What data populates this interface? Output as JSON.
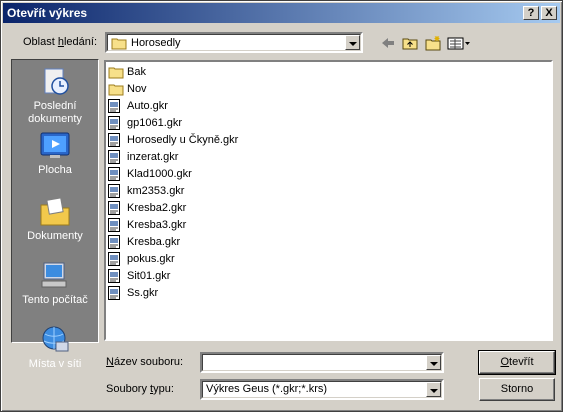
{
  "window": {
    "title": "Otevřít výkres"
  },
  "titlebar_buttons": {
    "help": "?",
    "close": "X"
  },
  "lookin": {
    "label_pre": "Oblast ",
    "label_u": "h",
    "label_post": "ledání:",
    "value": "Horosedly"
  },
  "places": [
    {
      "label1": "Poslední",
      "label2": "dokumenty",
      "icon": "recent-documents-icon"
    },
    {
      "label1": "Plocha",
      "label2": "",
      "icon": "desktop-icon"
    },
    {
      "label1": "Dokumenty",
      "label2": "",
      "icon": "my-documents-icon"
    },
    {
      "label1": "Tento počítač",
      "label2": "",
      "icon": "my-computer-icon"
    },
    {
      "label1": "Místa v síti",
      "label2": "",
      "icon": "network-places-icon"
    }
  ],
  "files": [
    {
      "name": "Bak",
      "type": "folder"
    },
    {
      "name": "Nov",
      "type": "folder"
    },
    {
      "name": "Auto.gkr",
      "type": "file"
    },
    {
      "name": "gp1061.gkr",
      "type": "file"
    },
    {
      "name": "Horosedly u Čkyně.gkr",
      "type": "file"
    },
    {
      "name": "inzerat.gkr",
      "type": "file"
    },
    {
      "name": "Klad1000.gkr",
      "type": "file"
    },
    {
      "name": "km2353.gkr",
      "type": "file"
    },
    {
      "name": "Kresba2.gkr",
      "type": "file"
    },
    {
      "name": "Kresba3.gkr",
      "type": "file"
    },
    {
      "name": "Kresba.gkr",
      "type": "file"
    },
    {
      "name": "pokus.gkr",
      "type": "file"
    },
    {
      "name": "Sit01.gkr",
      "type": "file"
    },
    {
      "name": "Ss.gkr",
      "type": "file"
    }
  ],
  "filename": {
    "label_u": "N",
    "label_post": "ázev souboru:",
    "value": ""
  },
  "filetype": {
    "label_pre": "Soubory ",
    "label_u": "t",
    "label_post": "ypu:",
    "value": "Výkres Geus (*.gkr;*.krs)"
  },
  "buttons": {
    "open_u": "O",
    "open_post": "tevřít",
    "cancel": "Storno"
  }
}
